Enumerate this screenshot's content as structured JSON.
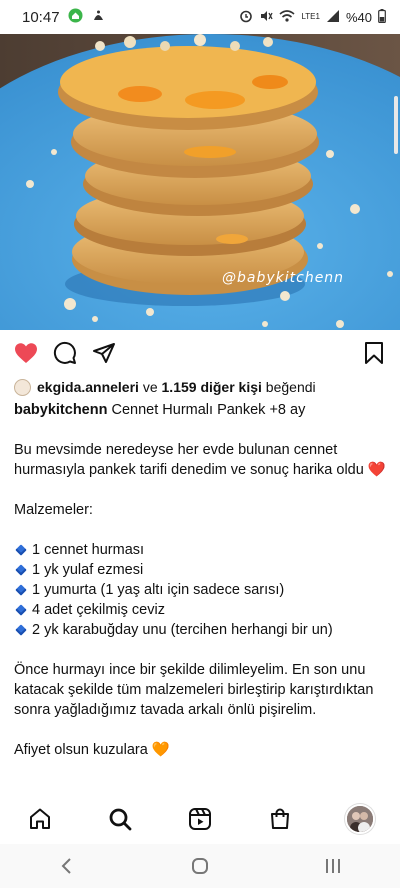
{
  "status_bar": {
    "time": "10:47",
    "battery": "%40",
    "signal_label": "LTE1"
  },
  "post": {
    "watermark": "@babykitchenn",
    "likes": {
      "first_user": "ekgida.anneleri",
      "connector": " ve ",
      "others": "1.159 diğer kişi",
      "suffix": " beğendi"
    },
    "caption": {
      "username": "babykitchenn",
      "title": " Cennet Hurmalı Pankek +8 ay",
      "intro": "Bu mevsimde neredeyse her evde bulunan cennet hurmasıyla pankek tarifi denedim ve sonuç harika oldu",
      "intro_emoji": "❤️",
      "ingredients_heading": "Malzemeler:",
      "ingredients": [
        "1 cennet hurması",
        "1 yk yulaf ezmesi",
        "1 yumurta (1 yaş altı için sadece sarısı)",
        "4 adet çekilmiş ceviz",
        "2 yk karabuğday unu (tercihen herhangi bir un)"
      ],
      "instructions": "Önce hurmayı ince bir şekilde dilimleyelim. En son unu katacak şekilde tüm malzemeleri birleştirip karıştırdıktan sonra yağladığımız tavada arkalı önlü pişirelim.",
      "closing": "Afiyet olsun kuzulara",
      "closing_emoji": "🧡"
    }
  },
  "colors": {
    "like_red": "#ed4956",
    "plate_blue": "#4aa3dc",
    "pancake": "#e2b36a"
  },
  "icons": {
    "actions": [
      "heart-icon",
      "comment-icon",
      "share-icon",
      "bookmark-icon"
    ],
    "bottom_nav": [
      "home-icon",
      "search-icon",
      "reels-icon",
      "shop-icon",
      "profile-avatar"
    ],
    "system_nav": [
      "back-icon",
      "home-circle-icon",
      "recent-apps-icon"
    ]
  }
}
